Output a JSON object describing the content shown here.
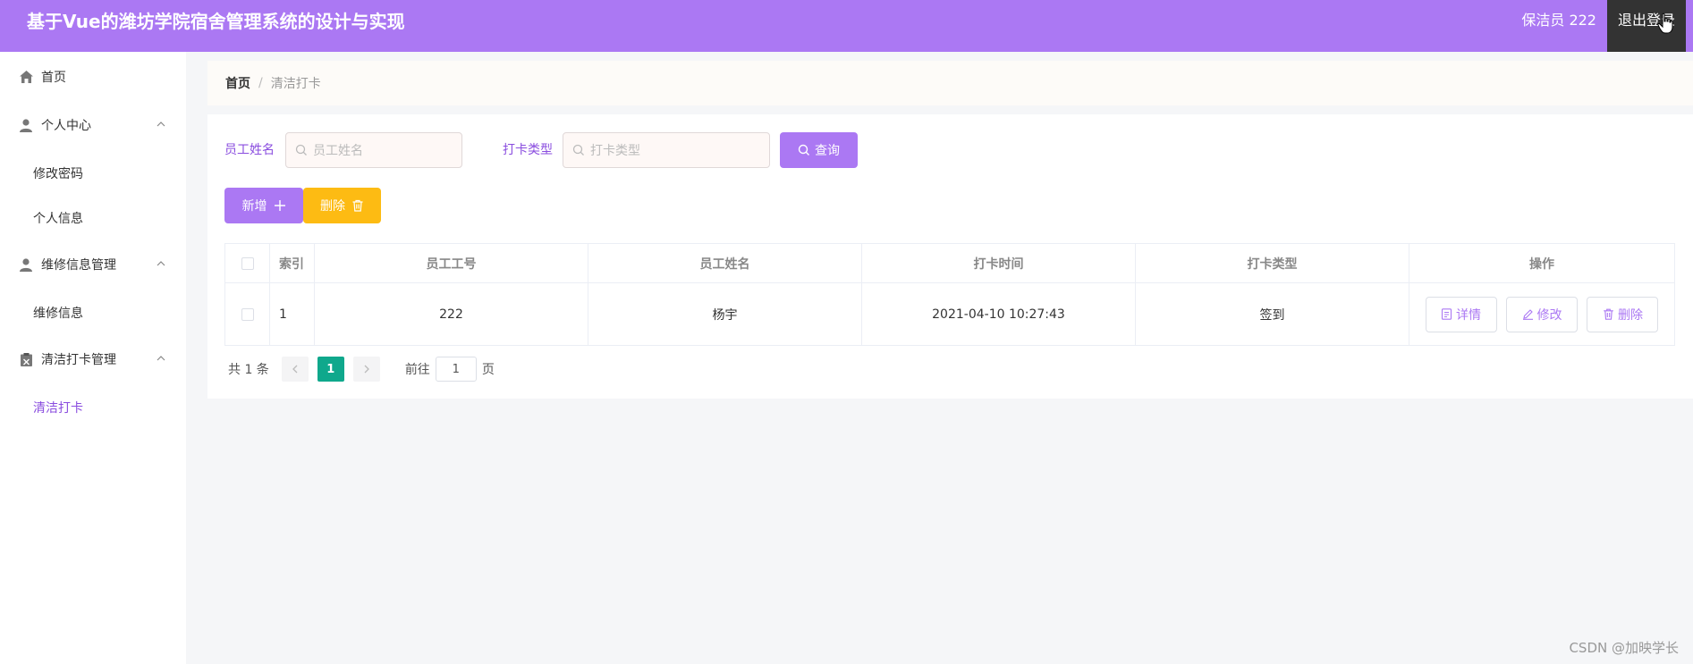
{
  "header": {
    "title": "基于Vue的潍坊学院宿舍管理系统的设计与实现",
    "user": "保洁员 222",
    "logout_label": "退出登录"
  },
  "sidebar": {
    "items": [
      {
        "label": "首页",
        "icon": "home-icon"
      },
      {
        "label": "个人中心",
        "icon": "user-icon",
        "children": [
          "修改密码",
          "个人信息"
        ]
      },
      {
        "label": "维修信息管理",
        "icon": "user-icon",
        "children": [
          "维修信息"
        ]
      },
      {
        "label": "清洁打卡管理",
        "icon": "clipboard-icon",
        "children": [
          "清洁打卡"
        ]
      }
    ],
    "active": "清洁打卡"
  },
  "breadcrumb": {
    "home": "首页",
    "separator": "/",
    "current": "清洁打卡"
  },
  "search": {
    "name_label": "员工姓名",
    "name_placeholder": "员工姓名",
    "type_label": "打卡类型",
    "type_placeholder": "打卡类型",
    "query_label": "查询"
  },
  "actions": {
    "add_label": "新增",
    "delete_label": "删除"
  },
  "table": {
    "columns": [
      "索引",
      "员工工号",
      "员工姓名",
      "打卡时间",
      "打卡类型",
      "操作"
    ],
    "rows": [
      {
        "index": "1",
        "emp_id": "222",
        "name": "杨宇",
        "time": "2021-04-10 10:27:43",
        "type": "签到"
      }
    ],
    "ops": {
      "detail": "详情",
      "edit": "修改",
      "delete": "删除"
    }
  },
  "pagination": {
    "total": "共 1 条",
    "current_page": "1",
    "goto_label": "前往",
    "goto_value": "1",
    "page_unit": "页"
  },
  "watermark": "CSDN @加映学长",
  "colors": {
    "header": "#ab78f3",
    "accent": "#8a4ddf",
    "warning": "#fdbb13",
    "page_active": "#0fa88c"
  }
}
